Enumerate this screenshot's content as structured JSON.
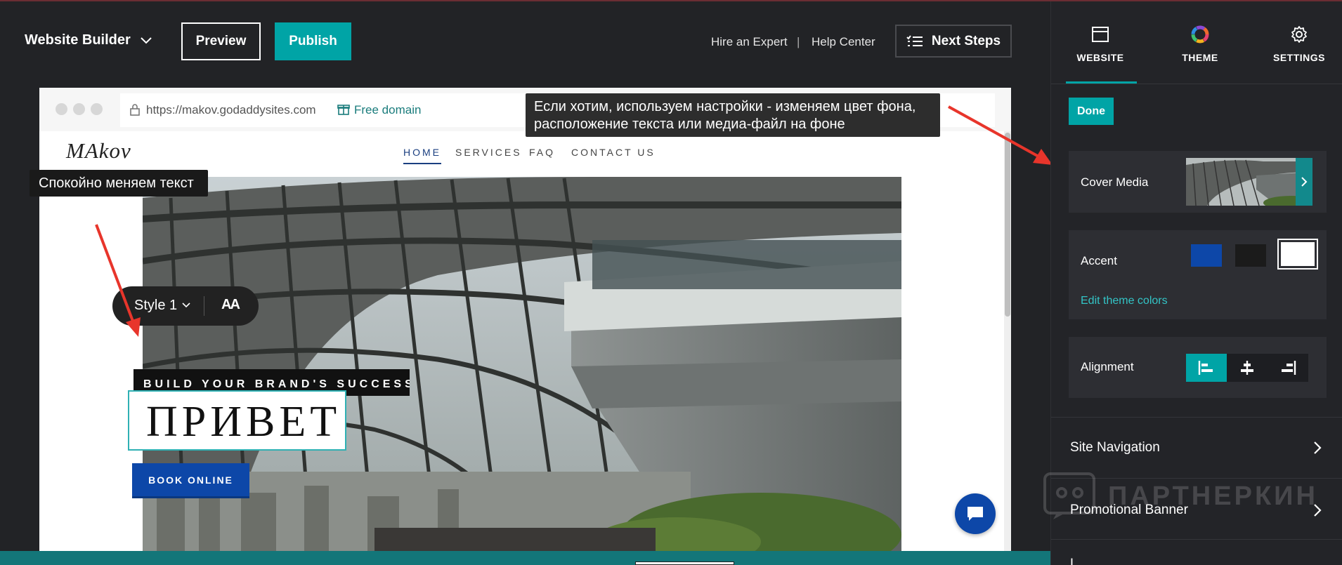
{
  "topbar": {
    "brand": "Website Builder",
    "preview": "Preview",
    "publish": "Publish",
    "hire": "Hire an Expert",
    "separator": "|",
    "help": "Help Center",
    "next_steps": "Next Steps"
  },
  "browser": {
    "url": "https://makov.godaddysites.com",
    "free_domain": "Free domain"
  },
  "site": {
    "logo": "MAkov",
    "nav": [
      "HOME",
      "SERVICES",
      "FAQ",
      "CONTACT US"
    ],
    "active_nav": "HOME",
    "style_label": "Style 1",
    "text_size_icon": "AA",
    "tagline": "BUILD YOUR BRAND'S SUCCESS",
    "headline": "ПРИВЕТ",
    "book_button": "BOOK ONLINE"
  },
  "annotations": {
    "right": "Если хотим, используем настройки - изменяем цвет фона, расположение текста или медиа-файл на фоне",
    "left": "Спокойно меняем текст"
  },
  "panel": {
    "tabs": [
      {
        "label": "WEBSITE",
        "icon": "browser-window-icon",
        "active": true
      },
      {
        "label": "THEME",
        "icon": "color-wheel-icon",
        "active": false
      },
      {
        "label": "SETTINGS",
        "icon": "gear-icon",
        "active": false
      }
    ],
    "done": "Done",
    "cover_media": "Cover Media",
    "accent": "Accent",
    "accent_colors": [
      "#0d47a8",
      "#1b1b1b",
      "#ffffff"
    ],
    "accent_selected": "#ffffff",
    "edit_theme_colors": "Edit theme colors",
    "alignment": "Alignment",
    "alignment_options": [
      "left",
      "center",
      "right"
    ],
    "alignment_selected": "left",
    "links": [
      "Site Navigation",
      "Promotional Banner",
      "L"
    ]
  },
  "watermark": "ПАРТНЕРКИН",
  "colors": {
    "accent_teal": "#00a4a6",
    "bg_dark": "#222326",
    "panel_card": "#2d2e33",
    "book_blue": "#0d47a8",
    "annotation_arrow": "#e8352b"
  }
}
